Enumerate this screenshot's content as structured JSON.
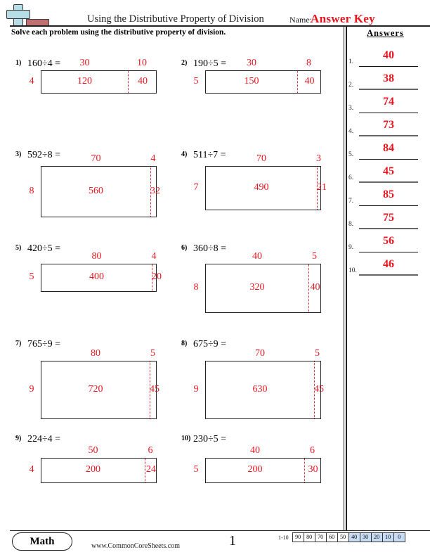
{
  "header": {
    "logo_icon": "plus-minus-logo-icon",
    "title": "Using the Distributive Property of Division",
    "name_label": "Name:",
    "name_value": "Answer Key"
  },
  "instructions": "Solve each problem using the distributive property of division.",
  "answers": {
    "header": "Answers",
    "items": [
      {
        "num": "1.",
        "value": "40"
      },
      {
        "num": "2.",
        "value": "38"
      },
      {
        "num": "3.",
        "value": "74"
      },
      {
        "num": "4.",
        "value": "73"
      },
      {
        "num": "5.",
        "value": "84"
      },
      {
        "num": "6.",
        "value": "45"
      },
      {
        "num": "7.",
        "value": "85"
      },
      {
        "num": "8.",
        "value": "75"
      },
      {
        "num": "9.",
        "value": "56"
      },
      {
        "num": "10.",
        "value": "46"
      }
    ]
  },
  "problems": [
    {
      "num": "1)",
      "expr": "160÷4 =",
      "divisor": "4",
      "top_left": "30",
      "top_right": "10",
      "left_product": "120",
      "right_product": "40"
    },
    {
      "num": "2)",
      "expr": "190÷5 =",
      "divisor": "5",
      "top_left": "30",
      "top_right": "8",
      "left_product": "150",
      "right_product": "40"
    },
    {
      "num": "3)",
      "expr": "592÷8 =",
      "divisor": "8",
      "top_left": "70",
      "top_right": "4",
      "left_product": "560",
      "right_product": "32"
    },
    {
      "num": "4)",
      "expr": "511÷7 =",
      "divisor": "7",
      "top_left": "70",
      "top_right": "3",
      "left_product": "490",
      "right_product": "21"
    },
    {
      "num": "5)",
      "expr": "420÷5 =",
      "divisor": "5",
      "top_left": "80",
      "top_right": "4",
      "left_product": "400",
      "right_product": "20"
    },
    {
      "num": "6)",
      "expr": "360÷8 =",
      "divisor": "8",
      "top_left": "40",
      "top_right": "5",
      "left_product": "320",
      "right_product": "40"
    },
    {
      "num": "7)",
      "expr": "765÷9 =",
      "divisor": "9",
      "top_left": "80",
      "top_right": "5",
      "left_product": "720",
      "right_product": "45"
    },
    {
      "num": "8)",
      "expr": "675÷9 =",
      "divisor": "9",
      "top_left": "70",
      "top_right": "5",
      "left_product": "630",
      "right_product": "45"
    },
    {
      "num": "9)",
      "expr": "224÷4 =",
      "divisor": "4",
      "top_left": "50",
      "top_right": "6",
      "left_product": "200",
      "right_product": "24"
    },
    {
      "num": "10)",
      "expr": "230÷5 =",
      "divisor": "5",
      "top_left": "40",
      "top_right": "6",
      "left_product": "200",
      "right_product": "30"
    }
  ],
  "footer": {
    "subject": "Math",
    "website": "www.CommonCoreSheets.com",
    "page": "1",
    "score_label": "1-10",
    "scores": [
      "90",
      "80",
      "70",
      "60",
      "50",
      "40",
      "30",
      "20",
      "10",
      "0"
    ],
    "highlight_color": "#c9dcf5"
  },
  "colors": {
    "answer_red": "#e8141e"
  }
}
